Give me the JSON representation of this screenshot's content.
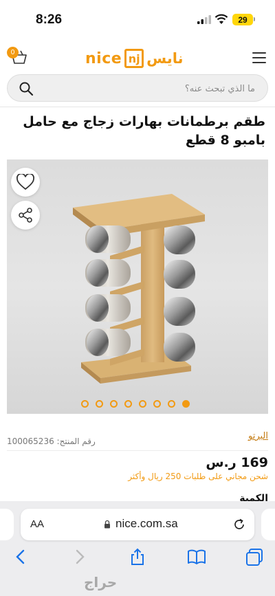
{
  "status_bar": {
    "time": "8:26",
    "battery": "29"
  },
  "header": {
    "cart_count": "0",
    "logo_en": "nice",
    "logo_box": "nj",
    "logo_ar": "نايس"
  },
  "search": {
    "placeholder": "ما الذي تبحث عنه؟"
  },
  "product": {
    "title": "طقم برطمانات بهارات زجاج مع حامل بامبو 8 قطع",
    "brand": "البرتو",
    "sku": "رقم المنتج: 100065236",
    "price": "169 ر.س",
    "shipping": "شحن مجاني على طلبات 250 ريال وأكثر",
    "quantity_label": "الكمية",
    "gallery_dots": 8,
    "active_dot": 7
  },
  "browser": {
    "text_size_label": "AA",
    "url": "nice.com.sa"
  },
  "watermark": "حراج",
  "colors": {
    "accent": "#f29a12",
    "wood": "#d8b074"
  }
}
